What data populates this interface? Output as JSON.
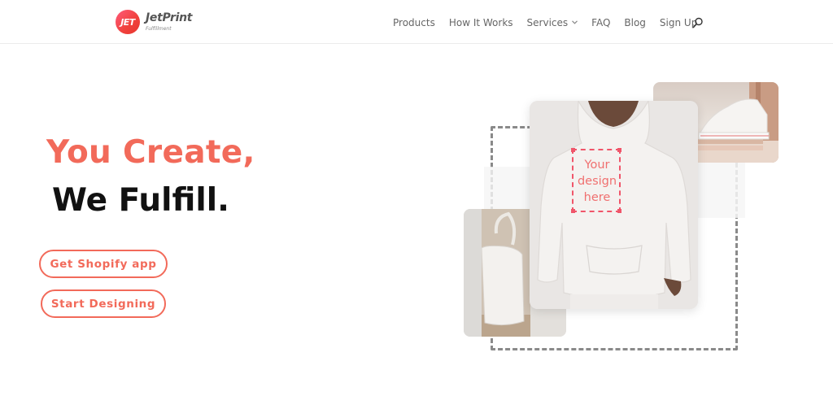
{
  "brand": {
    "badge": "JET",
    "name": "JetPrint",
    "tagline": "Fulfillment",
    "accent_color": "#f26a5a"
  },
  "nav": {
    "items": [
      {
        "label": "Products"
      },
      {
        "label": "How It Works"
      },
      {
        "label": "Services"
      },
      {
        "label": "FAQ"
      },
      {
        "label": "Blog"
      },
      {
        "label": "Sign Up"
      }
    ],
    "search_icon": "search-icon"
  },
  "hero": {
    "headline_1": "You Create,",
    "headline_2": "We Fulfill.",
    "button_shopify": "Get Shopify app",
    "button_design": "Start Designing"
  },
  "mockup": {
    "design_line_1": "Your",
    "design_line_2": "design",
    "design_line_3": "here"
  }
}
